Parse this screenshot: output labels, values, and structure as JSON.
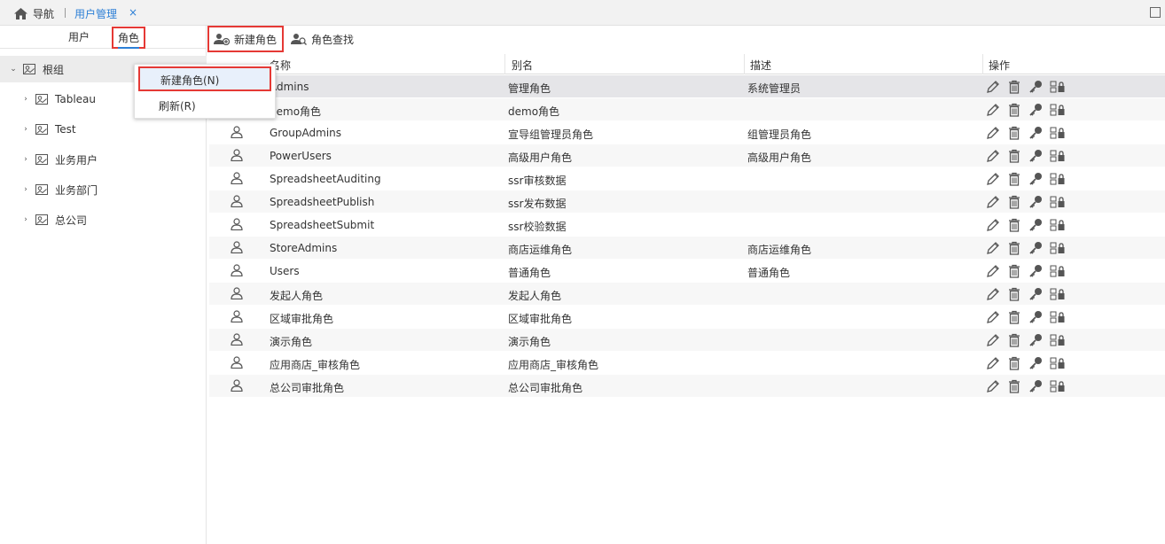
{
  "topbar": {
    "nav_label": "导航",
    "active_tab": "用户管理",
    "close_glyph": "×"
  },
  "left_tabs": {
    "user": "用户",
    "role": "角色"
  },
  "tree": [
    {
      "label": "根组",
      "arrow": "⌄"
    },
    {
      "label": "Tableau",
      "arrow": "›"
    },
    {
      "label": "Test",
      "arrow": "›"
    },
    {
      "label": "业务用户",
      "arrow": "›"
    },
    {
      "label": "业务部门",
      "arrow": "›"
    },
    {
      "label": "总公司",
      "arrow": "›"
    }
  ],
  "context_menu": {
    "new_role": "新建角色(N)",
    "refresh": "刷新(R)"
  },
  "toolbar": {
    "new_role": "新建角色",
    "find_role": "角色查找"
  },
  "columns": {
    "name": "名称",
    "alias": "别名",
    "desc": "描述",
    "ops": "操作"
  },
  "rows": [
    {
      "name": "Admins",
      "alias": "管理角色",
      "desc": "系统管理员"
    },
    {
      "name": "demo角色",
      "alias": "demo角色",
      "desc": ""
    },
    {
      "name": "GroupAdmins",
      "alias": "宣导组管理员角色",
      "desc": "组管理员角色"
    },
    {
      "name": "PowerUsers",
      "alias": "高级用户角色",
      "desc": "高级用户角色"
    },
    {
      "name": "SpreadsheetAuditing",
      "alias": "ssr审核数据",
      "desc": ""
    },
    {
      "name": "SpreadsheetPublish",
      "alias": "ssr发布数据",
      "desc": ""
    },
    {
      "name": "SpreadsheetSubmit",
      "alias": "ssr校验数据",
      "desc": ""
    },
    {
      "name": "StoreAdmins",
      "alias": "商店运维角色",
      "desc": "商店运维角色"
    },
    {
      "name": "Users",
      "alias": "普通角色",
      "desc": "普通角色"
    },
    {
      "name": "发起人角色",
      "alias": "发起人角色",
      "desc": ""
    },
    {
      "name": "区域审批角色",
      "alias": "区域审批角色",
      "desc": ""
    },
    {
      "name": "演示角色",
      "alias": "演示角色",
      "desc": ""
    },
    {
      "name": "应用商店_审核角色",
      "alias": "应用商店_审核角色",
      "desc": ""
    },
    {
      "name": "总公司审批角色",
      "alias": "总公司审批角色",
      "desc": ""
    }
  ],
  "colors": {
    "accent": "#2c7fd6",
    "highlight_border": "#e53935",
    "selected_row": "#e5e5e8"
  }
}
